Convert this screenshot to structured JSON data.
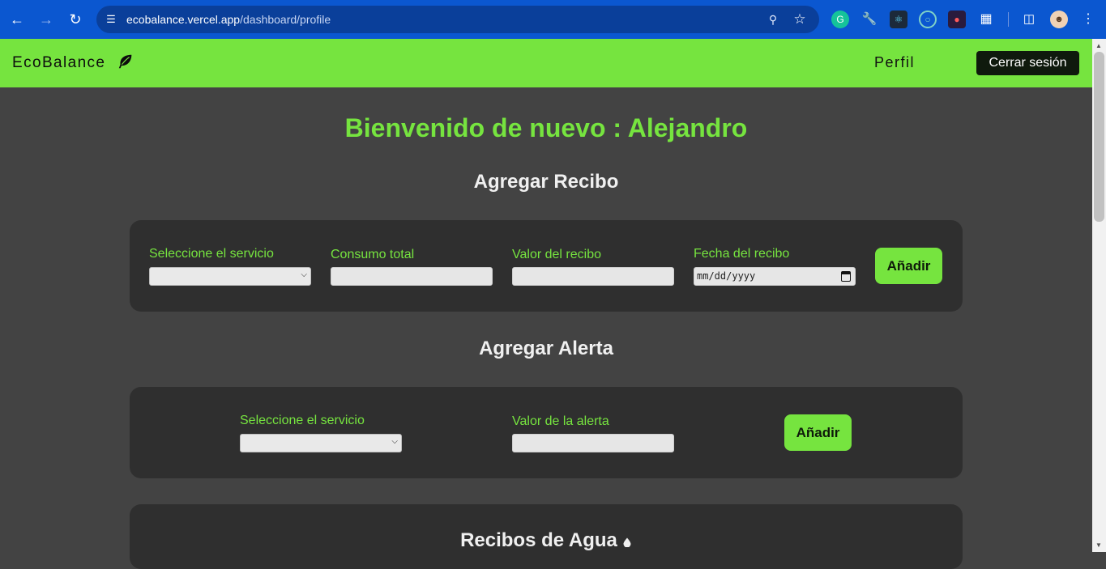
{
  "browser": {
    "url_host": "ecobalance.vercel.app",
    "url_path": "/dashboard/profile"
  },
  "header": {
    "brand": "EcoBalance",
    "nav_profile": "Perfil",
    "logout_label": "Cerrar sesión"
  },
  "main": {
    "welcome": "Bienvenido de nuevo : Alejandro",
    "receipt_section": {
      "title": "Agregar Recibo",
      "service_label": "Seleccione el servicio",
      "consumption_label": "Consumo total",
      "value_label": "Valor del recibo",
      "date_label": "Fecha del recibo",
      "date_placeholder": "mm/dd/yyyy",
      "add_label": "Añadir"
    },
    "alert_section": {
      "title": "Agregar Alerta",
      "service_label": "Seleccione el servicio",
      "value_label": "Valor de la alerta",
      "add_label": "Añadir"
    },
    "water_section": {
      "title": "Recibos de Agua"
    }
  },
  "colors": {
    "accent": "#76e43f",
    "background": "#434343",
    "card": "#2f2f2f",
    "browser_bar": "#0b57d0"
  }
}
